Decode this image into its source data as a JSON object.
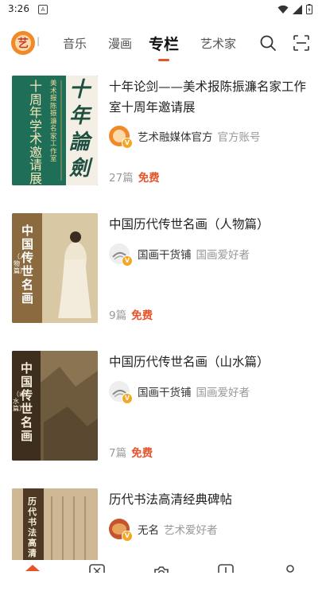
{
  "status": {
    "time": "3:26",
    "notif": "A"
  },
  "header": {
    "logo_char": "艺",
    "partial_tab": "l",
    "tabs": [
      {
        "label": "音乐",
        "active": false
      },
      {
        "label": "漫画",
        "active": false
      },
      {
        "label": "专栏",
        "active": true
      },
      {
        "label": "艺术家",
        "active": false
      }
    ]
  },
  "columns": [
    {
      "title": "十年论剑——美术报陈振濂名家工作室十周年邀请展",
      "author": "艺术融媒体官方",
      "author_tag": "官方账号",
      "count": "27篇",
      "price": "免费",
      "cover": {
        "bg": "#1f6e57",
        "lines": [
          "美术报陈振濂名家工作室",
          "十周年学术邀请展"
        ],
        "calligraphy": "十年論劍"
      }
    },
    {
      "title": "中国历代传世名画（人物篇）",
      "author": "国画干货铺",
      "author_tag": "国画爱好者",
      "count": "9篇",
      "price": "免费",
      "cover": {
        "bg": "#c9b58e",
        "big": "中国传世名画",
        "sub": "（人物篇）"
      }
    },
    {
      "title": "中国历代传世名画（山水篇）",
      "author": "国画干货铺",
      "author_tag": "国画爱好者",
      "count": "7篇",
      "price": "免费",
      "cover": {
        "bg": "#4a3a26",
        "big": "中国传世名画",
        "sub": "（山水篇）"
      }
    },
    {
      "title": "历代书法高清经典碑帖",
      "author": "无名",
      "author_tag": "艺术爱好者",
      "cover": {
        "bg": "#b8a07a",
        "big": "历代书法高清"
      }
    }
  ],
  "colors": {
    "accent": "#e8542a",
    "badge": "#f5a623",
    "muted": "#999999"
  },
  "icons": {
    "search": "search-icon",
    "scan": "scan-icon"
  }
}
